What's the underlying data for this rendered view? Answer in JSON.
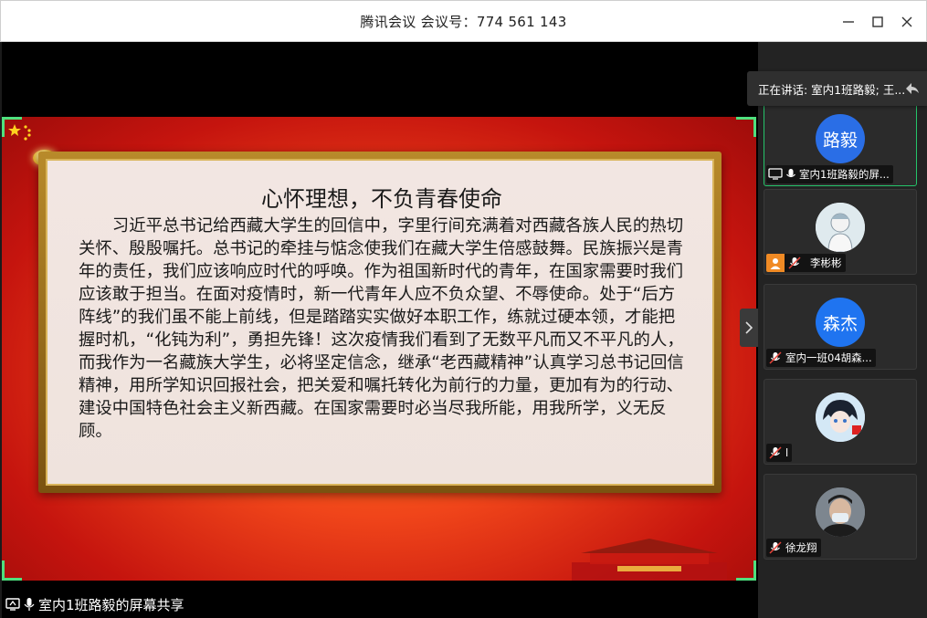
{
  "window": {
    "title": "腾讯会议 会议号：774 561 143"
  },
  "slide": {
    "title": "心怀理想，不负青春使命",
    "body": "习近平总书记给西藏大学生的回信中，字里行间充满着对西藏各族人民的热切关怀、殷殷嘱托。总书记的牵挂与惦念使我们在藏大学生倍感鼓舞。民族振兴是青年的责任，我们应该响应时代的呼唤。作为祖国新时代的青年，在国家需要时我们应该敢于担当。在面对疫情时，新一代青年人应不负众望、不辱使命。处于“后方阵线”的我们虽不能上前线，但是踏踏实实做好本职工作，练就过硬本领，才能把握时机，“化钝为利”，勇担先锋！这次疫情我们看到了无数平凡而又不平凡的人，而我作为一名藏族大学生，必将坚定信念，继承“老西藏精神”认真学习总书记回信精神，用所学知识回报社会，把关爱和嘱托转化为前行的力量，更加有为的行动、建设中国特色社会主义新西藏。在国家需要时必当尽我所能，用我所学，义无反顾。"
  },
  "share": {
    "label": "室内1班路毅的屏幕共享"
  },
  "speaking": {
    "text": "正在讲话: 室内1班路毅; 王..."
  },
  "participants": [
    {
      "avatar_text": "路毅",
      "name": "室内1班路毅的屏...",
      "kind": "screen"
    },
    {
      "avatar_text": "",
      "name": "李彬彬",
      "kind": "host"
    },
    {
      "avatar_text": "森杰",
      "name": "室内一班04胡森...",
      "kind": "muted"
    },
    {
      "avatar_text": "",
      "name": "l",
      "kind": "muted"
    },
    {
      "avatar_text": "",
      "name": "徐龙翔",
      "kind": "muted"
    }
  ],
  "colors": {
    "accent_green": "#25c46a",
    "avatar_blue": "#2a6ee6",
    "host_badge": "#f08a24"
  }
}
